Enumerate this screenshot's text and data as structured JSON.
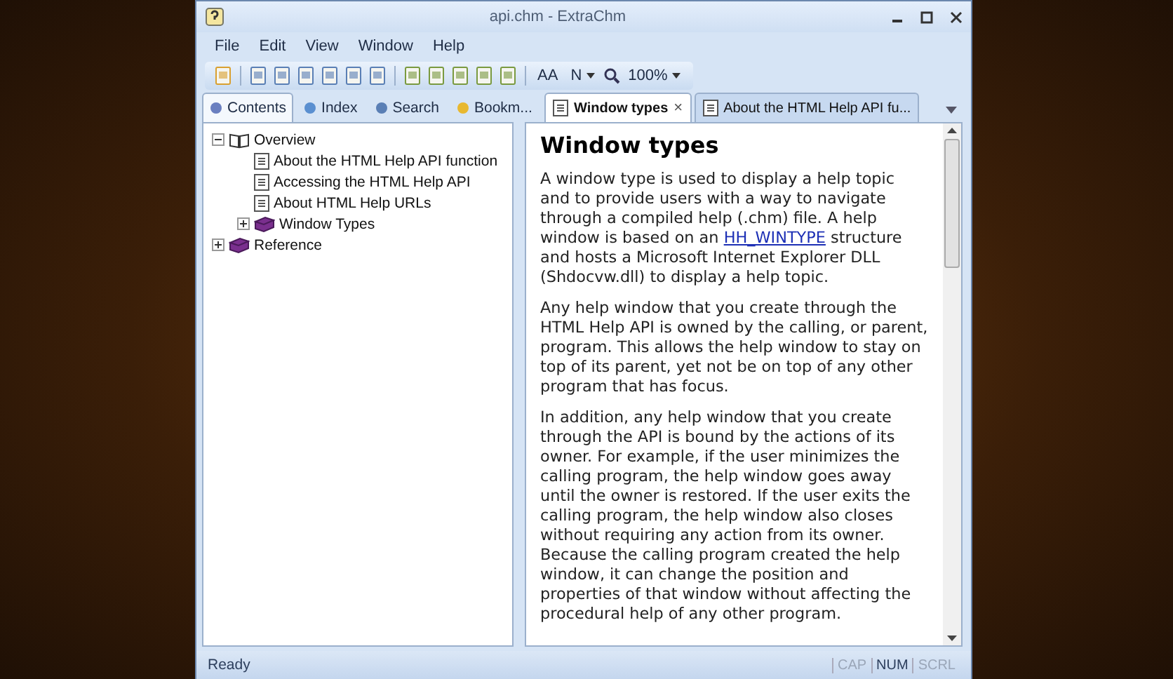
{
  "window": {
    "title": "api.chm - ExtraChm"
  },
  "menu": [
    "File",
    "Edit",
    "View",
    "Window",
    "Help"
  ],
  "toolbar": {
    "font_size": "AA",
    "style": "N",
    "zoom": "100%"
  },
  "nav_tabs": [
    {
      "label": "Contents",
      "selected": true
    },
    {
      "label": "Index",
      "selected": false
    },
    {
      "label": "Search",
      "selected": false
    },
    {
      "label": "Bookm...",
      "selected": false
    }
  ],
  "tree": [
    {
      "label": "Overview",
      "kind": "book",
      "expanded": true,
      "children": [
        {
          "label": "About the HTML Help API function",
          "kind": "page"
        },
        {
          "label": "Accessing the HTML Help API",
          "kind": "page"
        },
        {
          "label": "About HTML Help URLs",
          "kind": "page"
        },
        {
          "label": "Window Types",
          "kind": "book",
          "expanded": false
        }
      ]
    },
    {
      "label": "Reference",
      "kind": "book",
      "expanded": false
    }
  ],
  "doc_tabs": [
    {
      "label": "Window types",
      "selected": true,
      "close": "×"
    },
    {
      "label": "About the HTML Help API fu...",
      "selected": false
    }
  ],
  "document": {
    "heading": "Window types",
    "paragraphs": [
      {
        "text": "A window type is used to display a help topic and to provide users with a way to navigate through a compiled help (.chm) file. A help window is based on an ",
        "link": "HH_WINTYPE",
        "after": " structure and hosts a Microsoft Internet Explorer DLL (Shdocvw.dll) to display a help topic."
      },
      {
        "text": "Any help window that you create through the HTML Help API is owned by the calling, or parent, program. This allows the help window to stay on top of its parent, yet not be on top of any other program that has focus."
      },
      {
        "text": "In addition, any help window that you create through the API is bound by the actions of its owner. For example, if the user minimizes the calling program, the help window goes away until the owner is restored. If the user exits the calling program, the help window also closes without requiring any action from its owner. Because the calling program created the help window, it can change the position and properties of that window without affecting the procedural help of any other program."
      }
    ]
  },
  "status_bar": {
    "text": "Ready",
    "indicators": [
      {
        "label": "CAP",
        "on": false
      },
      {
        "label": "NUM",
        "on": true
      },
      {
        "label": "SCRL",
        "on": false
      }
    ]
  }
}
